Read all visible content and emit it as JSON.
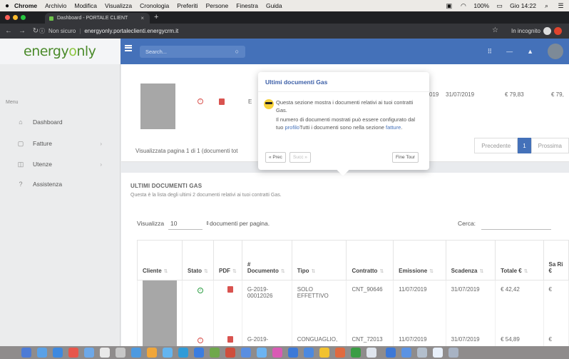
{
  "menubar": {
    "app": "Chrome",
    "items": [
      "Archivio",
      "Modifica",
      "Visualizza",
      "Cronologia",
      "Preferiti",
      "Persone",
      "Finestra",
      "Guida"
    ],
    "battery": "100%",
    "clock": "Gio 14:22"
  },
  "browser": {
    "tab_title": "Dashboard - PORTALE CLIENT",
    "security": "Non sicuro",
    "url": "energyonly.portaleclienti.energycrm.it",
    "incognito_label": "In incognito"
  },
  "app": {
    "logo_text_1": "energy",
    "logo_text_2": "o",
    "logo_text_3": "nly",
    "search_placeholder": "Search..."
  },
  "sidebar": {
    "menu_title": "Menu",
    "items": [
      {
        "label": "Dashboard",
        "icon": "home-icon"
      },
      {
        "label": "Fatture",
        "icon": "invoice-icon"
      },
      {
        "label": "Utenze",
        "icon": "utility-icon"
      },
      {
        "label": "Assistenza",
        "icon": "help-icon"
      }
    ]
  },
  "top_card": {
    "emission": "31/07/2019",
    "amount": "€ 79,83",
    "amount_cut": "€ 79,",
    "date_cut": "019",
    "showing": "Visualizzata pagina 1 di 1 (documenti tot",
    "prev": "Precedente",
    "page": "1",
    "next": "Prossima"
  },
  "gas_card": {
    "title": "ULTIMI DOCUMENTI GAS",
    "subtitle": "Questa è la lista degli ultimi 2 documenti relativi ai tuoi contratti Gas.",
    "length_label": "Visualizza",
    "length_value": "10",
    "length_after": "documenti per pagina.",
    "search_label": "Cerca:",
    "columns": [
      "Cliente",
      "Stato",
      "PDF",
      "# Documento",
      "Tipo",
      "Contratto",
      "Emissione",
      "Scadenza",
      "Totale €",
      "Sa Ri €"
    ],
    "rows": [
      {
        "documento": "G-2019-00012026",
        "tipo": "SOLO EFFETTIVO",
        "contratto": "CNT_90646",
        "emissione": "11/07/2019",
        "scadenza": "31/07/2019",
        "totale": "€ 42,42",
        "residuo": "€"
      },
      {
        "documento": "G-2019-",
        "tipo": "CONGUAGLIO,",
        "contratto": "CNT_72013",
        "emissione": "11/07/2019",
        "scadenza": "31/07/2019",
        "totale": "€ 54,89",
        "residuo": "€"
      }
    ]
  },
  "tour": {
    "title": "Ultimi documenti Gas",
    "body_1": "Questa sezione mostra i documenti relativi ai tuoi contratti Gas.",
    "body_2": "Il numero di documenti mostrati può essere configurato dal tuo ",
    "link_profile": "profilo",
    "body_3": "Tutti i documenti sono nella sezione ",
    "link_invoices": "fatture",
    "body_4": ".",
    "prev": "« Prec",
    "next": "Succ »",
    "end": "Fine Tour"
  },
  "colors": {
    "brand_blue": "#4471b9",
    "logo_green": "#4a8a2a",
    "status_red": "#d9534f",
    "status_green": "#2e9e44"
  }
}
